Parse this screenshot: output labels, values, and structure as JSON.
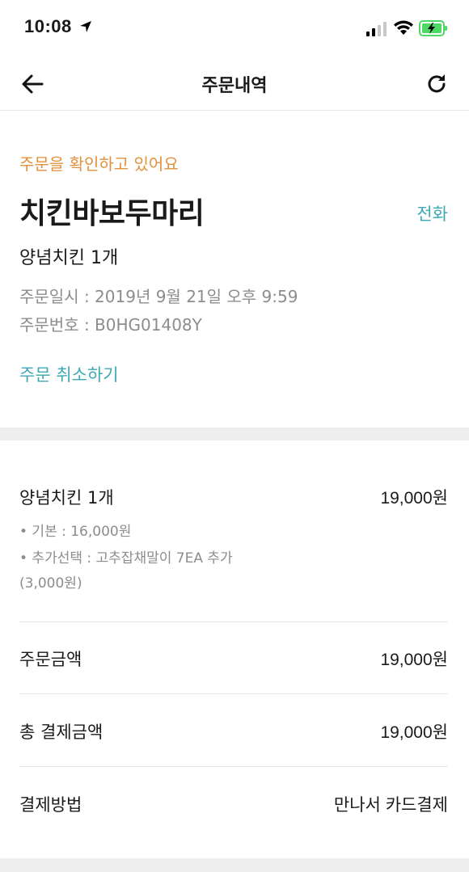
{
  "status_bar": {
    "time": "10:08",
    "icons": [
      "location-arrow-icon",
      "signal-icon",
      "wifi-icon",
      "battery-charging-icon"
    ],
    "battery_color": "#4cd964"
  },
  "nav": {
    "title": "주문내역",
    "back_icon": "arrow-left-icon",
    "refresh_icon": "refresh-icon"
  },
  "order": {
    "status_text": "주문을 확인하고 있어요",
    "store_name": "치킨바보두마리",
    "call_label": "전화",
    "summary": "양념치킨 1개",
    "date_text": "주문일시 : 2019년 9월 21일 오후 9:59",
    "number_text": "주문번호 : B0HG01408Y",
    "cancel_label": "주문 취소하기"
  },
  "details": {
    "item_name": "양념치킨 1개",
    "item_price": "19,000원",
    "option_base": "• 기본 : 16,000원",
    "option_extra_line1": "• 추가선택 : 고추잡채말이 7EA 추가",
    "option_extra_line2": "(3,000원)",
    "order_amount_label": "주문금액",
    "order_amount_value": "19,000원",
    "total_label": "총 결제금액",
    "total_value": "19,000원",
    "payment_label": "결제방법",
    "payment_value": "만나서 카드결제"
  },
  "colors": {
    "status_orange": "#e2913d",
    "accent_teal": "#3ea9b4",
    "muted_gray": "#8c8c8c"
  }
}
